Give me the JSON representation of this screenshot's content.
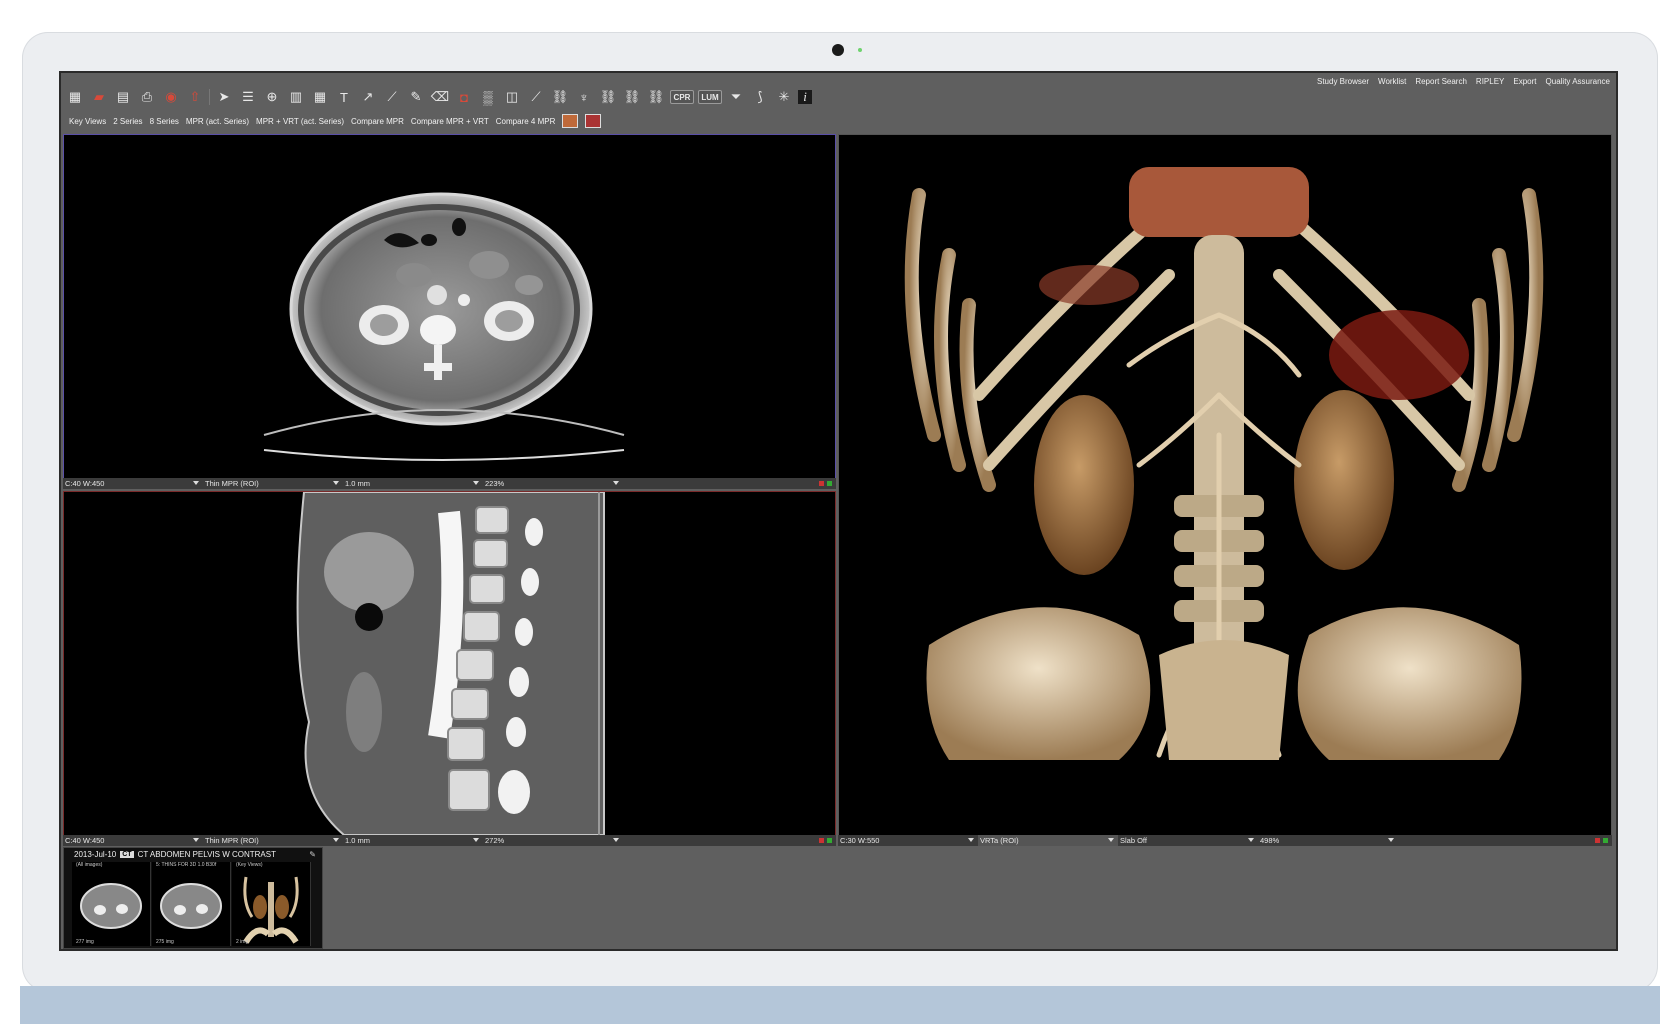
{
  "top_menu": [
    "Study Browser",
    "Worklist",
    "Report Search",
    "RIPLEY",
    "Export",
    "Quality Assurance"
  ],
  "toolbar": {
    "cpr_label": "CPR",
    "lum_label": "LUM",
    "info_label": "i"
  },
  "layouts": [
    "Key Views",
    "2 Series",
    "8 Series",
    "MPR (act. Series)",
    "MPR + VRT (act. Series)",
    "Compare MPR",
    "Compare MPR + VRT",
    "Compare 4 MPR"
  ],
  "viewports": {
    "axial": {
      "wl": "C:40 W:450",
      "mode": "Thin MPR (ROI)",
      "thickness": "1.0 mm",
      "zoom": "223%"
    },
    "sagittal": {
      "wl": "C:40 W:450",
      "mode": "Thin MPR (ROI)",
      "thickness": "1.0 mm",
      "zoom": "272%"
    },
    "volume": {
      "wl": "C:30 W:550",
      "mode": "VRTa (ROI)",
      "slab": "Slab Off",
      "zoom": "498%"
    }
  },
  "study": {
    "date": "2013-Jul-10",
    "modality": "CT",
    "description": "CT ABDOMEN PELVIS W CONTRAST",
    "series": [
      {
        "caption": "(All images)",
        "count": "277 img"
      },
      {
        "caption": "5: THINS FOR 3D 1.0 B30f",
        "count": "275 img"
      },
      {
        "caption": "(Key Views)",
        "count": "2 img"
      }
    ]
  },
  "colors": {
    "screen_bg": "#5f5f5f",
    "viewport_bg": "#000000",
    "stand": "#b4c6d9"
  }
}
